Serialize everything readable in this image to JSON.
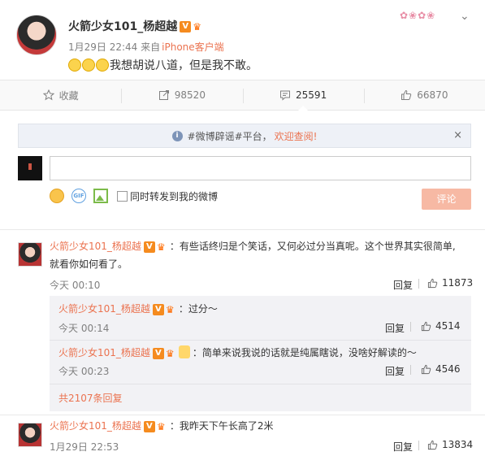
{
  "post": {
    "author": "火箭少女101_杨超越",
    "time": "1月29日 22:44",
    "source_prefix": "来自",
    "source": "iPhone客户端",
    "text": "我想胡说八道，但是我不敢。",
    "verified_mark": "V"
  },
  "actions": {
    "favorite": "收藏",
    "repost": "98520",
    "comment": "25591",
    "like": "66870"
  },
  "notice": {
    "text": "#微博辟谣#平台，",
    "link": "欢迎查阅!",
    "close": "×"
  },
  "composer": {
    "placeholder": "",
    "gif": "GIF",
    "repost_label": "同时转发到我的微博",
    "submit": "评论"
  },
  "comments": [
    {
      "user": "火箭少女101_杨超越",
      "text_line1": "：有些话终归是个笑话，又何必过分当真呢。这个世界其实很简单,",
      "text_line2": "就看你如何看了。",
      "time": "今天 00:10",
      "reply": "回复",
      "likes": "11873"
    },
    {
      "user": "火箭少女101_杨超越",
      "text": "：过分～",
      "time": "今天 00:14",
      "reply": "回复",
      "likes": "4514"
    },
    {
      "user": "火箭少女101_杨超越",
      "text": "：简单来说我说的话就是纯属瞎说，没啥好解读的～",
      "time": "今天 00:23",
      "reply": "回复",
      "likes": "4546"
    },
    {
      "user": "火箭少女101_杨超越",
      "text": "：我昨天下午长高了2米",
      "time": "1月29日 22:53",
      "reply": "回复",
      "likes": "13834"
    }
  ],
  "more_replies": "共2107条回复",
  "colors": {
    "accent": "#eb7350",
    "submit_bg": "#f7b9a4",
    "verified": "#f58b1f"
  }
}
